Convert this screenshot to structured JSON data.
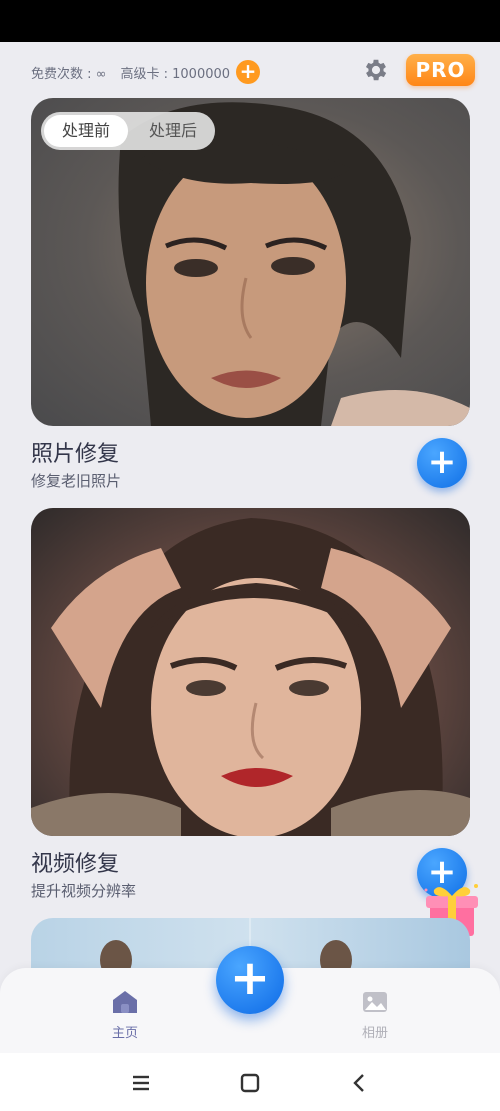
{
  "topbar": {
    "free_label": "免费次数 : ∞",
    "premium_label": "高级卡 : 1000000",
    "add_icon": "plus-icon",
    "settings_icon": "gear-icon",
    "pro_badge": "PRO"
  },
  "cards": [
    {
      "title": "照片修复",
      "subtitle": "修复老旧照片",
      "toggle": {
        "before": "处理前",
        "after": "处理后",
        "selected": "处理前"
      }
    },
    {
      "title": "视频修复",
      "subtitle": "提升视频分辨率"
    }
  ],
  "bottom_nav": {
    "home_label": "主页",
    "album_label": "相册"
  },
  "colors": {
    "accent_blue": "#1a7ef0",
    "pro_orange": "#ff8c1f",
    "nav_active": "#6a6fa8"
  }
}
